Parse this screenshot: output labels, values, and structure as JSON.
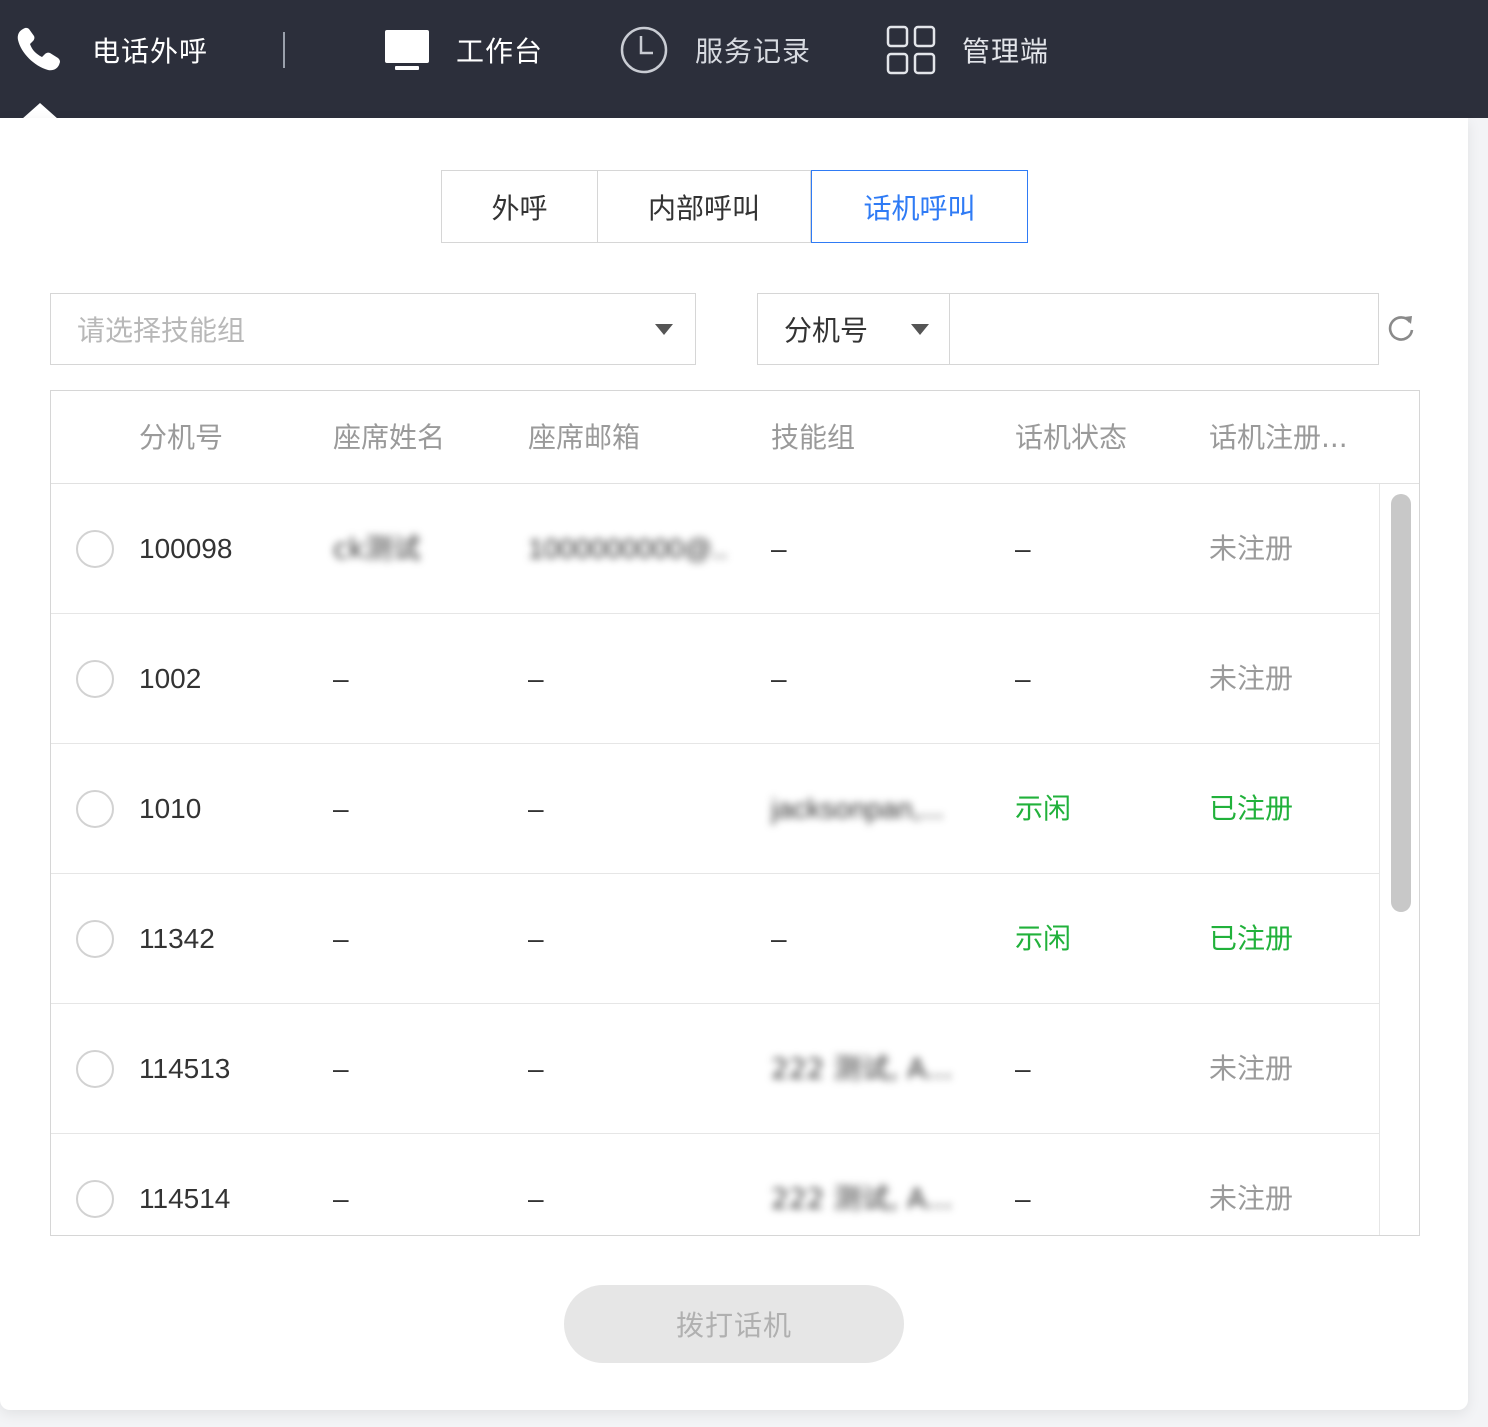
{
  "topnav": {
    "phone_label": "电话外呼",
    "workbench_label": "工作台",
    "history_label": "服务记录",
    "admin_label": "管理端"
  },
  "tabs": [
    "外呼",
    "内部呼叫",
    "话机呼叫"
  ],
  "active_tab": "话机呼叫",
  "filters": {
    "skill_placeholder": "请选择技能组",
    "ext_type": "分机号",
    "search_value": ""
  },
  "table": {
    "columns": [
      "分机号",
      "座席姓名",
      "座席邮箱",
      "技能组",
      "话机状态",
      "话机注册..."
    ],
    "rows": [
      {
        "ext": "100098",
        "name": "ck测试",
        "email": "1000000000@...",
        "skill": "–",
        "state": "–",
        "reg": "未注册"
      },
      {
        "ext": "1002",
        "name": "–",
        "email": "–",
        "skill": "–",
        "state": "–",
        "reg": "未注册"
      },
      {
        "ext": "1010",
        "name": "–",
        "email": "–",
        "skill": "jacksonpan,...",
        "state": "示闲",
        "reg": "已注册"
      },
      {
        "ext": "11342",
        "name": "–",
        "email": "–",
        "skill": "–",
        "state": "示闲",
        "reg": "已注册"
      },
      {
        "ext": "114513",
        "name": "–",
        "email": "–",
        "skill": "222 测试, A...",
        "state": "–",
        "reg": "未注册"
      },
      {
        "ext": "114514",
        "name": "–",
        "email": "–",
        "skill": "222 测试, A...",
        "state": "–",
        "reg": "未注册"
      }
    ]
  },
  "dial_button": "拨打话机",
  "colors": {
    "topbar": "#2c2f3b",
    "accent": "#2f7bf5",
    "status_green": "#21b13b",
    "muted": "#9a9a9a"
  }
}
